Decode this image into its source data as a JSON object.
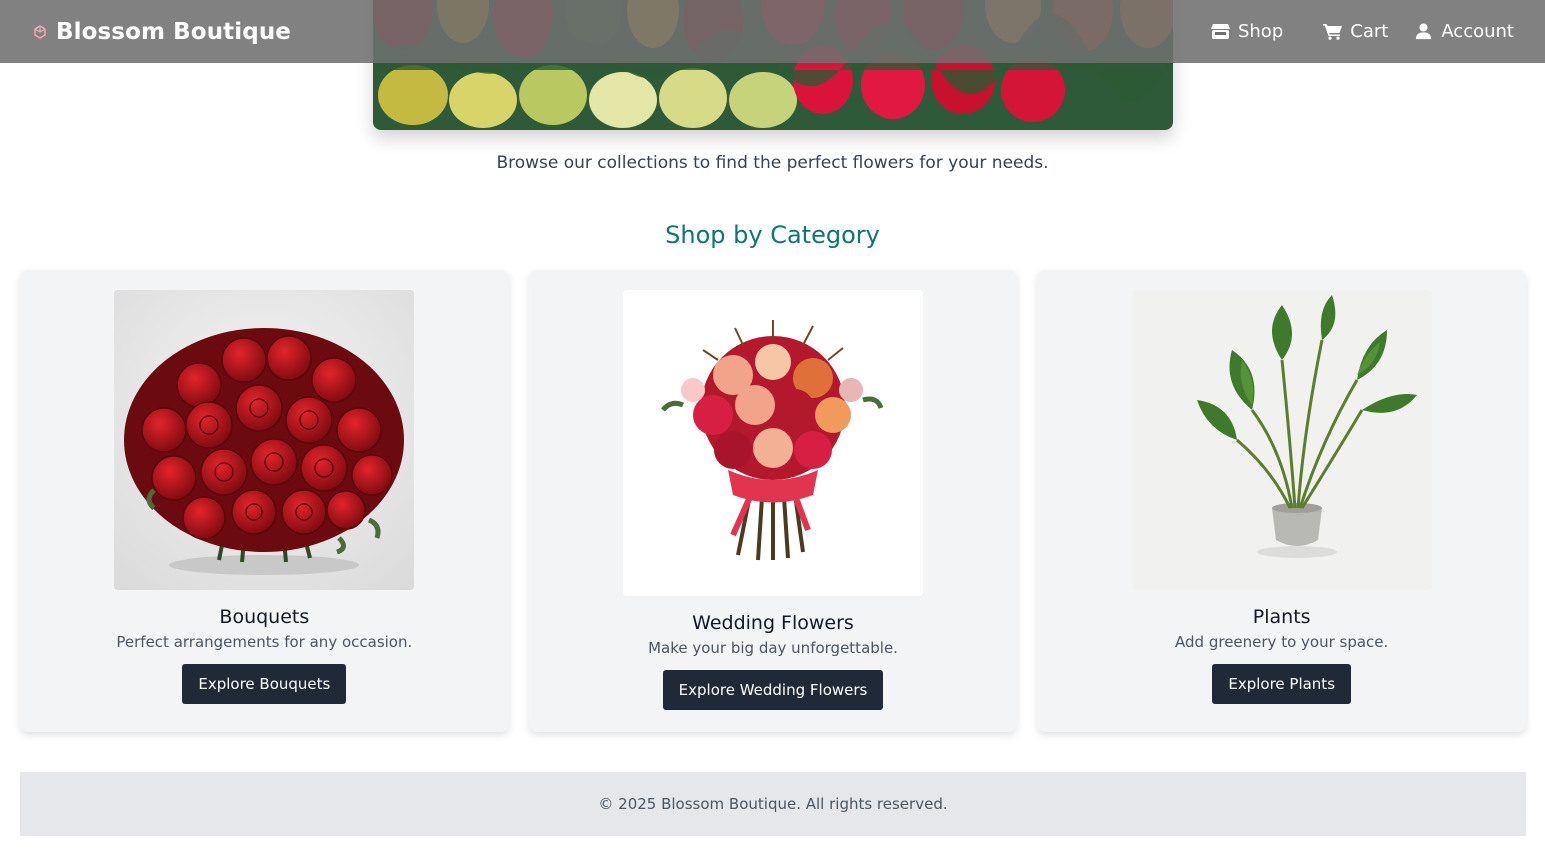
{
  "header": {
    "brand": "Blossom Boutique",
    "nav": [
      {
        "label": "Shop",
        "icon": "store-icon"
      },
      {
        "label": "Cart",
        "icon": "cart-icon"
      },
      {
        "label": "Account",
        "icon": "user-icon"
      }
    ]
  },
  "intro": "Browse our collections to find the perfect flowers for your needs.",
  "section_title": "Shop by Category",
  "categories": [
    {
      "title": "Bouquets",
      "description": "Perfect arrangements for any occasion.",
      "button": "Explore Bouquets"
    },
    {
      "title": "Wedding Flowers",
      "description": "Make your big day unforgettable.",
      "button": "Explore Wedding Flowers"
    },
    {
      "title": "Plants",
      "description": "Add greenery to your space.",
      "button": "Explore Plants"
    }
  ],
  "footer": "© 2025 Blossom Boutique. All rights reserved.",
  "colors": {
    "accent": "#0f766e",
    "button": "#1f2937",
    "card_bg": "#f3f4f6",
    "footer_bg": "#e5e7eb"
  }
}
